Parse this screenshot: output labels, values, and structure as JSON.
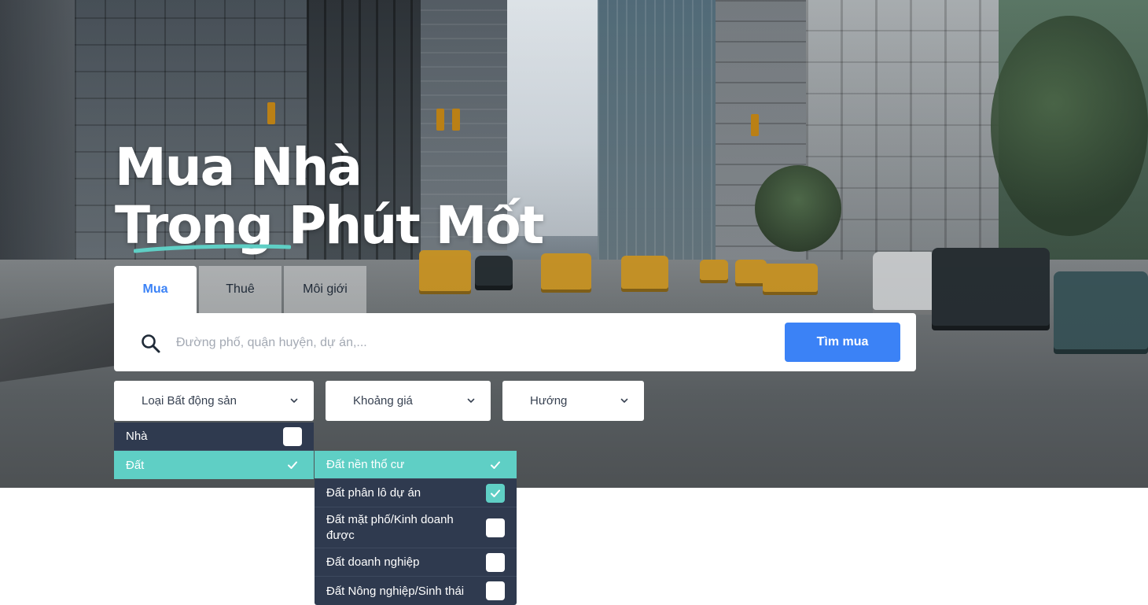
{
  "hero": {
    "headline_line1": "Mua Nhà",
    "headline_line2": "Trong Phút Mốt"
  },
  "tabs": [
    {
      "label": "Mua",
      "active": true
    },
    {
      "label": "Thuê",
      "active": false
    },
    {
      "label": "Môi giới",
      "active": false
    }
  ],
  "search": {
    "placeholder": "Đường phố, quận huyện, dự án,...",
    "value": "",
    "button_label": "Tìm mua"
  },
  "filters": [
    {
      "label": "Loại Bất động sản"
    },
    {
      "label": "Khoảng giá"
    },
    {
      "label": "Hướng"
    }
  ],
  "property_type_menu": [
    {
      "label": "Nhà",
      "checked": false,
      "selected": false
    },
    {
      "label": "Đất",
      "checked": true,
      "selected": true
    }
  ],
  "land_submenu": [
    {
      "label": "Đất nền thổ cư",
      "checked": true,
      "selected": true
    },
    {
      "label": "Đất phân lô dự án",
      "checked": true,
      "selected": false
    },
    {
      "label": "Đất mặt phố/Kinh doanh được",
      "checked": false,
      "selected": false
    },
    {
      "label": "Đất doanh nghiệp",
      "checked": false,
      "selected": false
    },
    {
      "label": "Đất Nông nghiệp/Sinh thái",
      "checked": false,
      "selected": false
    }
  ],
  "colors": {
    "primary": "#3b82f6",
    "accent_teal": "#5fcfc5",
    "menu_bg": "#2f3a4f",
    "text_dark": "#1f2a37"
  },
  "icons": {
    "search": "search-icon",
    "chevron": "chevron-down-icon",
    "check": "check-icon"
  }
}
